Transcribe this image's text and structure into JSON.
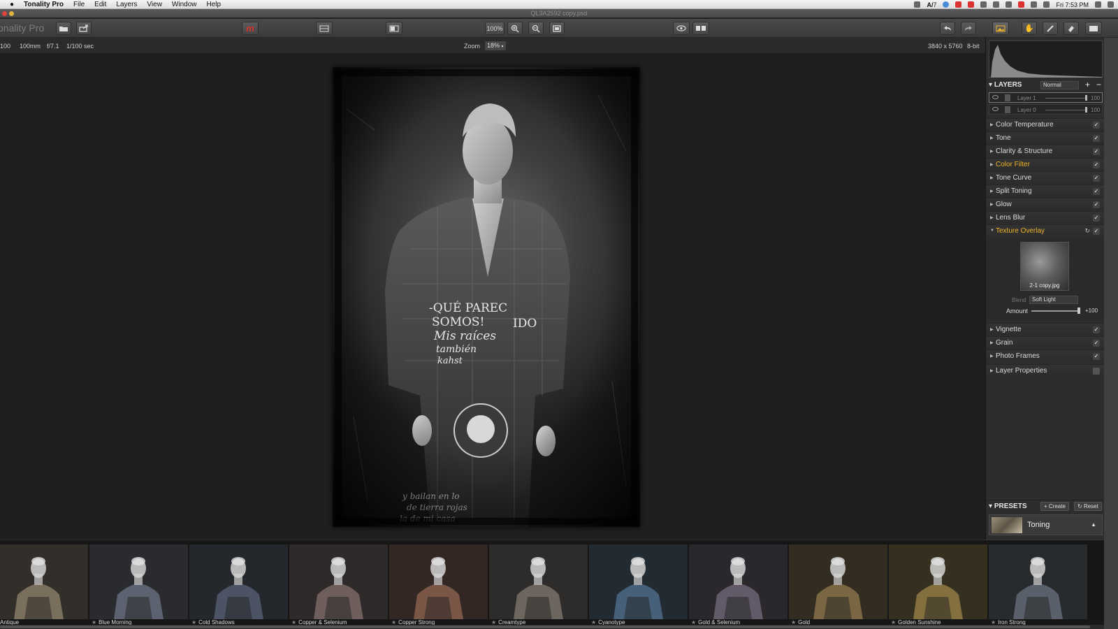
{
  "menubar": {
    "app_name": "Tonality Pro",
    "items": [
      "File",
      "Edit",
      "Layers",
      "View",
      "Window",
      "Help"
    ],
    "status_text": "7",
    "clock": "Fri 7:53 PM"
  },
  "window": {
    "title": "QL3A2592 copy.psd"
  },
  "toolbar": {
    "app_name": "onality Pro",
    "zoom_percent": "100%"
  },
  "infobar": {
    "iso": "100",
    "focal": "100mm",
    "aperture": "f/7.1",
    "shutter": "1/100 sec",
    "zoom_label": "Zoom",
    "zoom_value": "18%",
    "dimensions": "3840 x 5760",
    "bitdepth": "8-bit"
  },
  "layers": {
    "title": "LAYERS",
    "blend_mode": "Normal",
    "rows": [
      {
        "name": "Layer 1",
        "opacity": "100"
      },
      {
        "name": "Layer 0",
        "opacity": "100"
      }
    ]
  },
  "adjustments": [
    {
      "label": "Color Temperature",
      "active": false
    },
    {
      "label": "Tone",
      "active": false
    },
    {
      "label": "Clarity & Structure",
      "active": false
    },
    {
      "label": "Color Filter",
      "active": true
    },
    {
      "label": "Tone Curve",
      "active": false
    },
    {
      "label": "Split Toning",
      "active": false
    },
    {
      "label": "Glow",
      "active": false
    },
    {
      "label": "Lens Blur",
      "active": false
    },
    {
      "label": "Texture Overlay",
      "active": true
    }
  ],
  "texture_overlay": {
    "texture_name": "2-1 copy.jpg",
    "blend_label": "Blend",
    "blend_value": "Soft Light",
    "amount_label": "Amount",
    "amount_value": "+100",
    "amount_fraction": 1.0
  },
  "adjustments_after": [
    {
      "label": "Vignette"
    },
    {
      "label": "Grain"
    },
    {
      "label": "Photo Frames"
    },
    {
      "label": "Layer Properties"
    }
  ],
  "presets": {
    "title": "PRESETS",
    "create_label": "Create",
    "reset_label": "Reset",
    "selected": "Toning"
  },
  "filmstrip": [
    {
      "label": "Antique",
      "tint": "#7a6f5c"
    },
    {
      "label": "Blue Morning",
      "tint": "#5d6270"
    },
    {
      "label": "Cold Shadows",
      "tint": "#4b5364"
    },
    {
      "label": "Copper & Selenium",
      "tint": "#6e5f5c"
    },
    {
      "label": "Copper Strong",
      "tint": "#7a5646"
    },
    {
      "label": "Creamtype",
      "tint": "#6c665e"
    },
    {
      "label": "Cyanotype",
      "tint": "#47607a"
    },
    {
      "label": "Gold & Selenium",
      "tint": "#625a68"
    },
    {
      "label": "Gold",
      "tint": "#7a6642"
    },
    {
      "label": "Golden Sunshine",
      "tint": "#83703e"
    },
    {
      "label": "Iron Strong",
      "tint": "#59606b"
    }
  ],
  "colors": {
    "accent": "#f0b429",
    "logo_red": "#d9332b"
  }
}
